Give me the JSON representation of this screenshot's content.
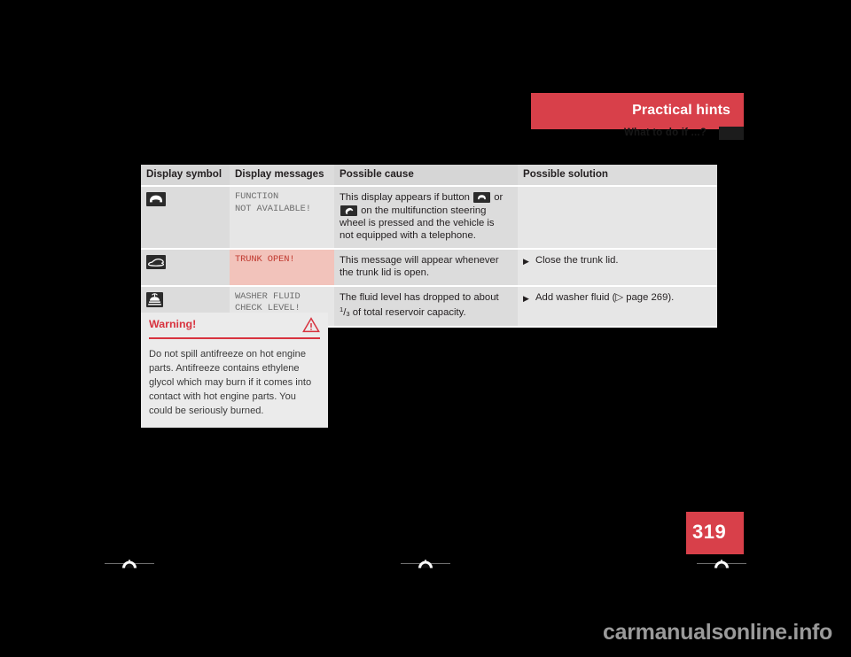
{
  "header": {
    "band_title": "Practical hints",
    "subtitle": "What to do if ...?"
  },
  "table": {
    "columns": [
      "Display symbol",
      "Display messages",
      "Possible cause",
      "Possible solution"
    ],
    "rows": [
      {
        "symbol_icon": "phone-hangup-icon",
        "message": "FUNCTION\nNOT AVAILABLE!",
        "message_style": "gray",
        "cause_part1": "This display appears if button ",
        "cause_icon1": "phone-hangup-icon",
        "cause_part2": " or ",
        "cause_icon2": "phone-pickup-icon",
        "cause_part3": " on the multifunction steering wheel is pressed and the vehicle is not equipped with a telephone.",
        "solution": ""
      },
      {
        "symbol_icon": "trunk-open-icon",
        "message": "TRUNK OPEN!",
        "message_style": "red",
        "cause": "This message will appear whenever the trunk lid is open.",
        "solution": "Close the trunk lid."
      },
      {
        "symbol_icon": "washer-fluid-icon",
        "message": "WASHER FLUID\nCHECK LEVEL!",
        "message_style": "gray",
        "cause_prefix": "The fluid level has dropped to about ",
        "cause_fraction_num": "1",
        "cause_fraction_den": "3",
        "cause_suffix": " of total reservoir capacity.",
        "solution": "Add washer fluid (▷ page 269)."
      }
    ],
    "bullet_glyph": "▶"
  },
  "warning": {
    "title": "Warning!",
    "icon": "warning-triangle-icon",
    "body": "Do not spill antifreeze on hot engine parts. Antifreeze contains ethylene glycol which may burn if it comes into contact with hot engine parts. You could be seriously burned."
  },
  "page_number": "319",
  "watermark": "carmanualsonline.info",
  "colors": {
    "accent_red": "#d8404a",
    "warning_red": "#d8333f",
    "message_gray": "#6d6d6d",
    "alert_pink": "#f2c3bb"
  }
}
